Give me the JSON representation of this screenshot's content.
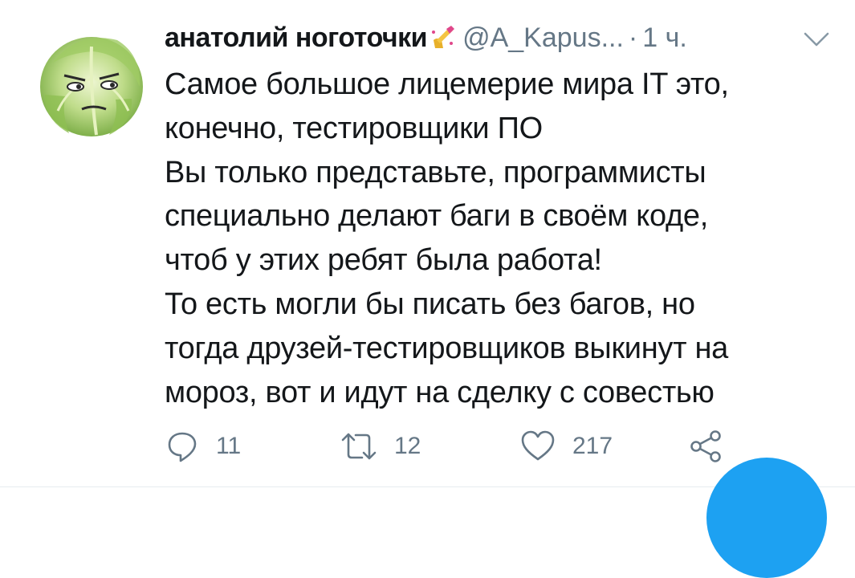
{
  "tweet": {
    "display_name": "анатолий ноготочки",
    "handle": "@A_Kapus...",
    "separator": "·",
    "time": "1 ч.",
    "lines": [
      "Самое большое лицемерие мира IT это,",
      "конечно, тестировщики ПО",
      "Вы только представьте, программисты",
      "специально делают баги в своём коде,",
      "чтоб у этих ребят была работа!",
      "То есть могли бы писать без багов, но",
      "тогда друзей-тестировщиков выкинут на",
      "мороз, вот и идут на сделку с совестью"
    ],
    "actions": {
      "replies": "11",
      "retweets": "12",
      "likes": "217"
    }
  },
  "icons": {
    "avatar": "cabbage-avatar",
    "emoji": "nail-polish-emoji",
    "caret": "chevron-down-icon",
    "reply": "reply-icon",
    "retweet": "retweet-icon",
    "like": "heart-icon",
    "share": "share-icon",
    "fab": "compose-fab"
  },
  "colors": {
    "text": "#14171a",
    "muted": "#657786",
    "accent": "#1da1f2"
  }
}
